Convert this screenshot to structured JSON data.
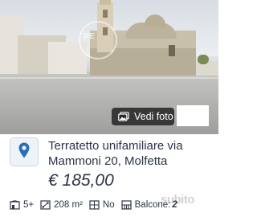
{
  "photo": {
    "watermark_text": "RE",
    "view_photos_label": "Vedi foto",
    "icon": "gallery-icon"
  },
  "listing": {
    "logo_icon": "map-pin-icon",
    "title": "Terratetto unifamiliare via Mammoni 20, Molfetta",
    "price": "€ 185,00"
  },
  "features": {
    "rooms": {
      "icon": "rooms-icon",
      "value": "5+"
    },
    "area": {
      "icon": "area-icon",
      "value": "208 m²"
    },
    "garden": {
      "icon": "garden-icon",
      "value": "No"
    },
    "balcony": {
      "icon": "balcony-icon",
      "label": "Balcone:",
      "value": "2"
    }
  },
  "brand_watermark": "subito",
  "colors": {
    "text": "#2b3345",
    "pin": "#2d6fb6",
    "button_bg": "#282828"
  }
}
